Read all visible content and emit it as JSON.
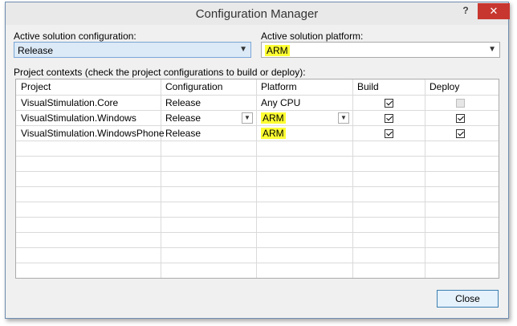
{
  "dialog": {
    "title": "Configuration Manager",
    "help_label": "?",
    "close_glyph": "✕"
  },
  "active_config": {
    "label": "Active solution configuration:",
    "value": "Release"
  },
  "active_platform": {
    "label": "Active solution platform:",
    "value": "ARM"
  },
  "project_contexts_label": "Project contexts (check the project configurations to build or deploy):",
  "grid": {
    "columns": [
      "Project",
      "Configuration",
      "Platform",
      "Build",
      "Deploy"
    ],
    "rows": [
      {
        "project": "VisualStimulation.Core",
        "configuration": "Release",
        "platform": "Any CPU",
        "build": true,
        "deploy": false,
        "deploy_enabled": false
      },
      {
        "project": "VisualStimulation.Windows",
        "configuration": "Release",
        "platform": "ARM",
        "build": true,
        "deploy": true,
        "deploy_enabled": true
      },
      {
        "project": "VisualStimulation.WindowsPhone",
        "configuration": "Release",
        "platform": "ARM",
        "build": true,
        "deploy": true,
        "deploy_enabled": true
      }
    ]
  },
  "buttons": {
    "close_label": "Close"
  },
  "colors": {
    "highlight": "#ffff33",
    "titlebar_close": "#c7372f"
  }
}
